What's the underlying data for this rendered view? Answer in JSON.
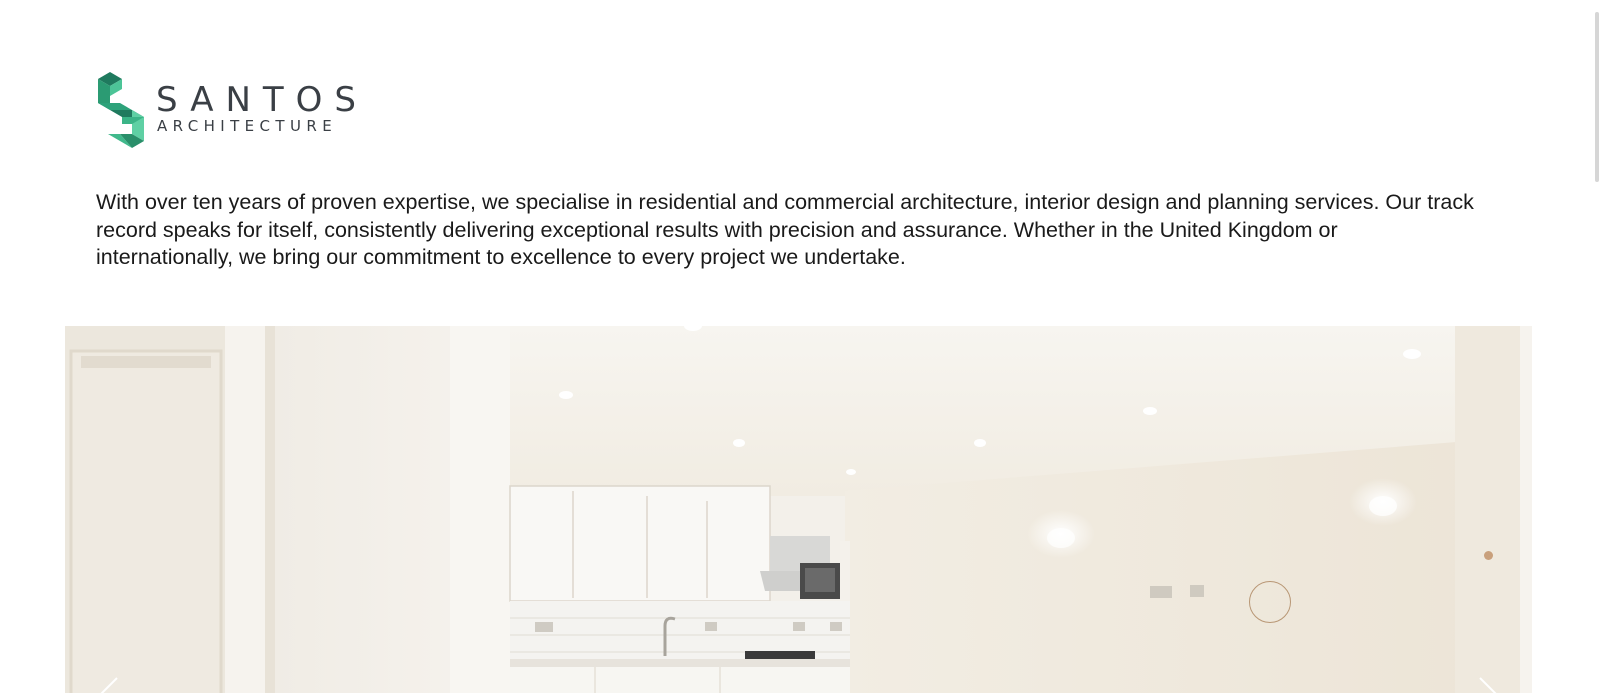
{
  "brand": {
    "name": "SANTOS",
    "tagline": "ARCHITECTURE",
    "colors": {
      "mark_dark": "#1f7a5e",
      "mark_mid": "#2da27a",
      "mark_light": "#5fd0a4",
      "text": "#3a3f45"
    }
  },
  "intro": {
    "text": "With over ten years of proven expertise, we specialise in residential and commercial architecture, interior design and planning services. Our track record speaks for itself, consistently delivering exceptional results with precision and assurance. Whether in the United Kingdom or internationally, we bring our commitment to excellence to every project we undertake."
  },
  "slider": {
    "image_subject": "white modern kitchen interior",
    "prev_icon": "chevron-left-icon",
    "next_icon": "chevron-right-icon",
    "accent_color": "#c9a07c"
  }
}
